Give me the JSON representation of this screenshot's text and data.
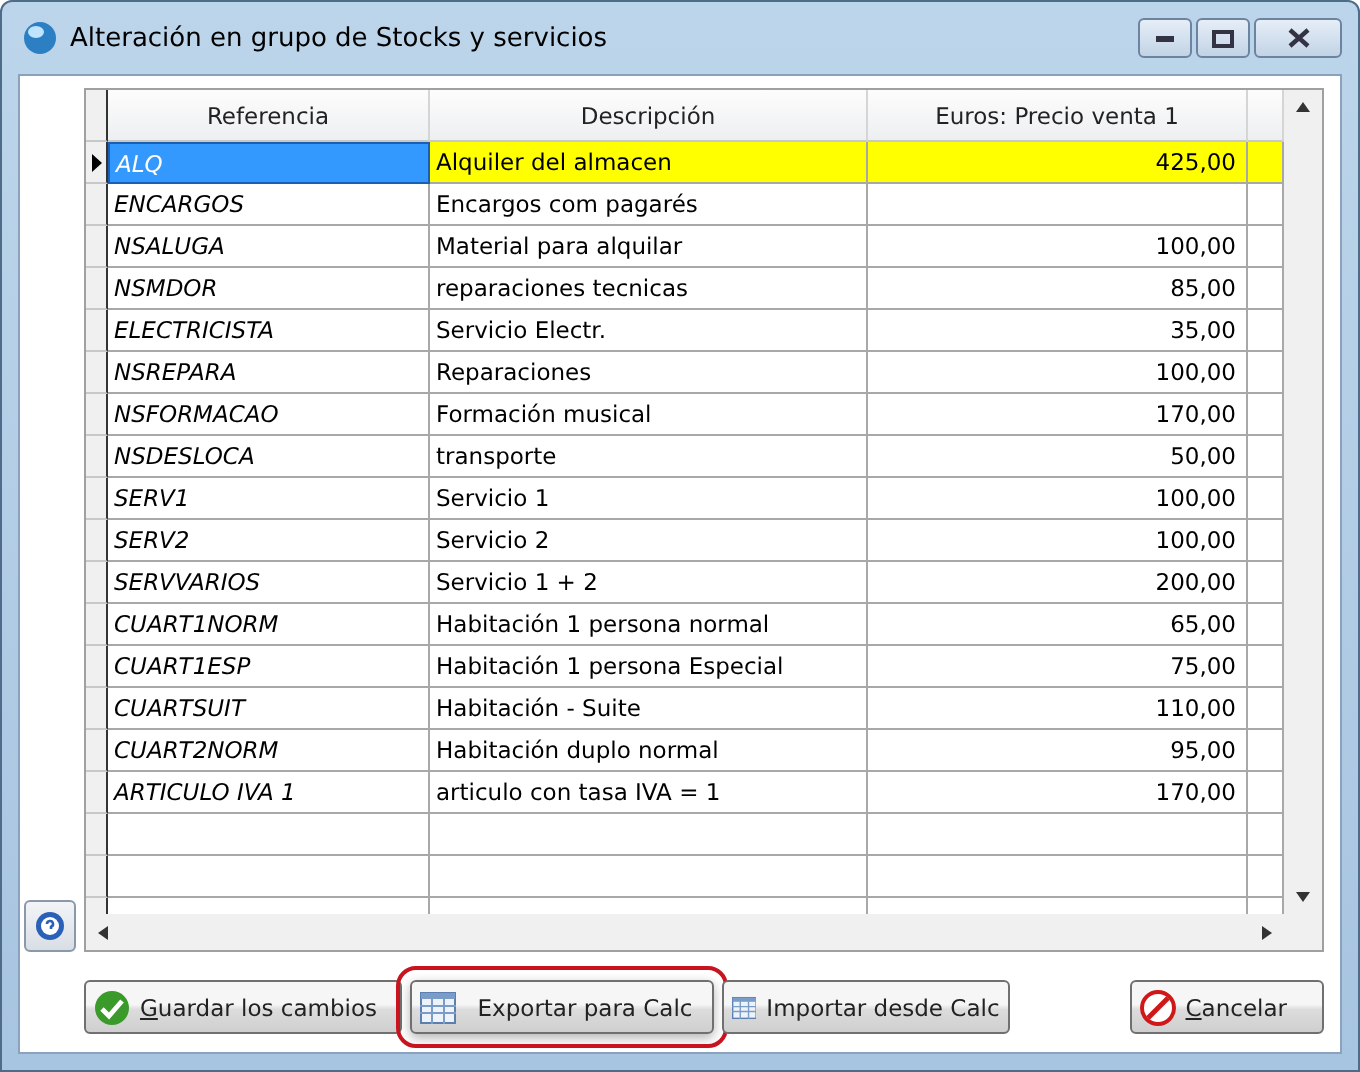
{
  "window": {
    "title": "Alteración en grupo de  Stocks y servicios"
  },
  "table": {
    "columns": [
      "Referencia",
      "Descripción",
      "Euros: Precio venta 1"
    ],
    "rows": [
      {
        "ref": "ALQ",
        "desc": "Alquiler del almacen",
        "price": "425,00",
        "selected": true
      },
      {
        "ref": "ENCARGOS",
        "desc": "Encargos com pagarés",
        "selected": false
      },
      {
        "ref": "NSALUGA",
        "desc": "Material para alquilar",
        "price": "100,00",
        "selected": false
      },
      {
        "ref": "NSMDOR",
        "desc": "reparaciones tecnicas",
        "price": "85,00",
        "selected": false
      },
      {
        "ref": "ELECTRICISTA",
        "desc": "Servicio Electr.",
        "price": "35,00",
        "selected": false
      },
      {
        "ref": "NSREPARA",
        "desc": "Reparaciones",
        "price": "100,00",
        "selected": false
      },
      {
        "ref": "NSFORMACAO",
        "desc": "Formación musical",
        "price": "170,00",
        "selected": false
      },
      {
        "ref": "NSDESLOCA",
        "desc": "transporte",
        "price": "50,00",
        "selected": false
      },
      {
        "ref": "SERV1",
        "desc": "Servicio 1",
        "price": "100,00",
        "selected": false
      },
      {
        "ref": "SERV2",
        "desc": "Servicio 2",
        "price": "100,00",
        "selected": false
      },
      {
        "ref": "SERVVARIOS",
        "desc": "Servicio 1 + 2",
        "price": "200,00",
        "selected": false
      },
      {
        "ref": "CUART1NORM",
        "desc": "Habitación 1 persona normal",
        "price": "65,00",
        "selected": false
      },
      {
        "ref": "CUART1ESP",
        "desc": "Habitación 1 persona Especial",
        "price": "75,00",
        "selected": false
      },
      {
        "ref": "CUARTSUIT",
        "desc": "Habitación - Suite",
        "price": "110,00",
        "selected": false
      },
      {
        "ref": "CUART2NORM",
        "desc": "Habitación duplo normal",
        "price": "95,00",
        "selected": false
      },
      {
        "ref": "ARTICULO IVA 1",
        "desc": "articulo con tasa IVA = 1",
        "price": "170,00",
        "selected": false
      }
    ]
  },
  "buttons": [
    {
      "label": "Guardar los cambios",
      "kind": "save",
      "mnemonic_first": true,
      "highlighted": false
    },
    {
      "label": "Exportar para Calc",
      "kind": "sheet",
      "mnemonic_first": false,
      "highlighted": true
    },
    {
      "label": "Importar desde Calc",
      "kind": "sheet",
      "mnemonic_first": false,
      "highlighted": false
    },
    {
      "label": "Cancelar",
      "kind": "cancel",
      "mnemonic_first": true,
      "highlighted": false
    }
  ]
}
